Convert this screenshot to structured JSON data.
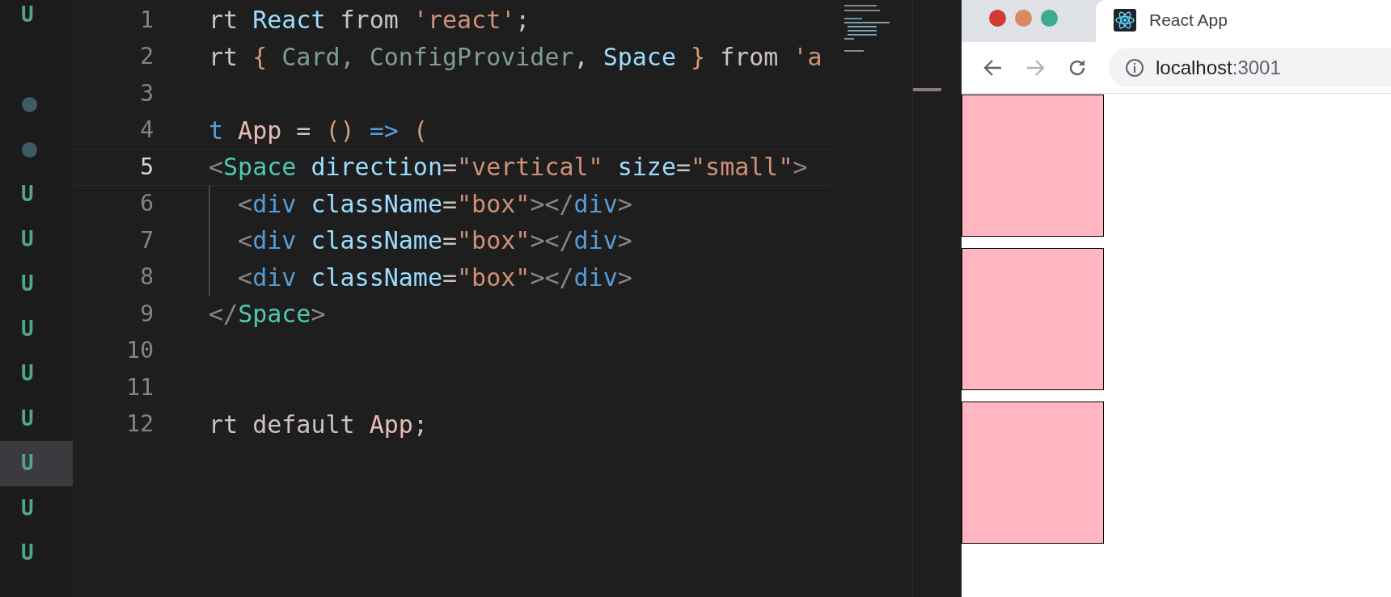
{
  "source_control": {
    "rows": [
      {
        "kind": "status",
        "text": "U",
        "selected": false
      },
      {
        "kind": "blank"
      },
      {
        "kind": "dot",
        "selected": false
      },
      {
        "kind": "dot",
        "selected": false
      },
      {
        "kind": "status",
        "text": "U",
        "selected": false
      },
      {
        "kind": "status",
        "text": "U",
        "selected": false
      },
      {
        "kind": "status",
        "text": "U",
        "selected": false
      },
      {
        "kind": "status",
        "text": "U",
        "selected": false
      },
      {
        "kind": "status",
        "text": "U",
        "selected": false
      },
      {
        "kind": "status",
        "text": "U",
        "selected": false
      },
      {
        "kind": "status",
        "text": "U",
        "selected": true
      },
      {
        "kind": "status",
        "text": "U",
        "selected": false
      },
      {
        "kind": "status",
        "text": "U",
        "selected": false
      }
    ]
  },
  "editor": {
    "lines": [
      {
        "number": "1",
        "current": false,
        "guide": false,
        "tokens": [
          {
            "text": "rt ",
            "kind": "plain"
          },
          {
            "text": "React",
            "kind": "ident"
          },
          {
            "text": " from ",
            "kind": "plain"
          },
          {
            "text": "'react'",
            "kind": "string"
          },
          {
            "text": ";",
            "kind": "plain"
          }
        ]
      },
      {
        "number": "2",
        "current": false,
        "guide": false,
        "tokens": [
          {
            "text": "rt ",
            "kind": "plain"
          },
          {
            "text": "{",
            "kind": "bracket"
          },
          {
            "text": " Card, ConfigProvider",
            "kind": "faded"
          },
          {
            "text": ", ",
            "kind": "plain"
          },
          {
            "text": "Space ",
            "kind": "ident"
          },
          {
            "text": "}",
            "kind": "bracket"
          },
          {
            "text": " from ",
            "kind": "plain"
          },
          {
            "text": "'a",
            "kind": "string"
          }
        ]
      },
      {
        "number": "3",
        "current": false,
        "guide": false
      },
      {
        "number": "4",
        "current": false,
        "guide": false,
        "tokens": [
          {
            "text": "t",
            "kind": "keyword"
          },
          {
            "text": " App",
            "kind": "name"
          },
          {
            "text": " = ",
            "kind": "plain"
          },
          {
            "text": "()",
            "kind": "bracket"
          },
          {
            "text": " => ",
            "kind": "keyword"
          },
          {
            "text": "(",
            "kind": "bracket"
          }
        ]
      },
      {
        "number": "5",
        "current": true,
        "guide": false,
        "tokens": [
          {
            "text": "<",
            "kind": "punct"
          },
          {
            "text": "Space",
            "kind": "component"
          },
          {
            "text": " direction",
            "kind": "ident"
          },
          {
            "text": "=",
            "kind": "plain"
          },
          {
            "text": "\"vertical\"",
            "kind": "string"
          },
          {
            "text": " size",
            "kind": "ident"
          },
          {
            "text": "=",
            "kind": "plain"
          },
          {
            "text": "\"small\"",
            "kind": "string"
          },
          {
            "text": ">",
            "kind": "punct"
          }
        ]
      },
      {
        "number": "6",
        "current": false,
        "guide": true,
        "tokens": [
          {
            "text": "  <",
            "kind": "punct"
          },
          {
            "text": "div",
            "kind": "keyword"
          },
          {
            "text": " className",
            "kind": "ident"
          },
          {
            "text": "=",
            "kind": "plain"
          },
          {
            "text": "\"box\"",
            "kind": "string"
          },
          {
            "text": "></",
            "kind": "punct"
          },
          {
            "text": "div",
            "kind": "keyword"
          },
          {
            "text": ">",
            "kind": "punct"
          }
        ]
      },
      {
        "number": "7",
        "current": false,
        "guide": true,
        "tokens": [
          {
            "text": "  <",
            "kind": "punct"
          },
          {
            "text": "div",
            "kind": "keyword"
          },
          {
            "text": " className",
            "kind": "ident"
          },
          {
            "text": "=",
            "kind": "plain"
          },
          {
            "text": "\"box\"",
            "kind": "string"
          },
          {
            "text": "></",
            "kind": "punct"
          },
          {
            "text": "div",
            "kind": "keyword"
          },
          {
            "text": ">",
            "kind": "punct"
          }
        ]
      },
      {
        "number": "8",
        "current": false,
        "guide": true,
        "tokens": [
          {
            "text": "  <",
            "kind": "punct"
          },
          {
            "text": "div",
            "kind": "keyword"
          },
          {
            "text": " className",
            "kind": "ident"
          },
          {
            "text": "=",
            "kind": "plain"
          },
          {
            "text": "\"box\"",
            "kind": "string"
          },
          {
            "text": "></",
            "kind": "punct"
          },
          {
            "text": "div",
            "kind": "keyword"
          },
          {
            "text": ">",
            "kind": "punct"
          }
        ]
      },
      {
        "number": "9",
        "current": false,
        "guide": false,
        "tokens": [
          {
            "text": "</",
            "kind": "punct"
          },
          {
            "text": "Space",
            "kind": "component"
          },
          {
            "text": ">",
            "kind": "punct"
          }
        ]
      },
      {
        "number": "10",
        "current": false,
        "guide": false
      },
      {
        "number": "11",
        "current": false,
        "guide": false
      },
      {
        "number": "12",
        "current": false,
        "guide": false,
        "tokens": [
          {
            "text": "rt default ",
            "kind": "plain"
          },
          {
            "text": "App",
            "kind": "name"
          },
          {
            "text": ";",
            "kind": "plain"
          }
        ]
      }
    ]
  },
  "browser": {
    "tab_title": "React App",
    "url_host": "localhost",
    "url_port": ":3001",
    "page": {
      "boxes": [
        {
          "kind": "box"
        },
        {
          "kind": "box"
        },
        {
          "kind": "box"
        }
      ]
    }
  }
}
